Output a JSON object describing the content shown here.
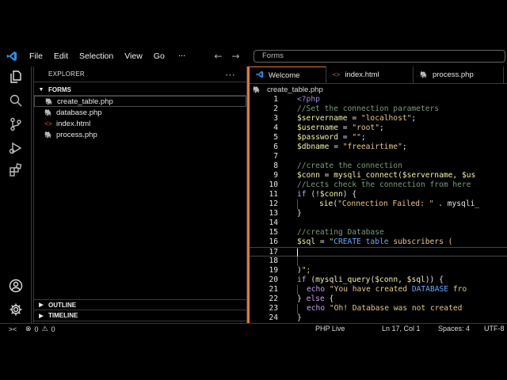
{
  "title_bar": {
    "menu": [
      "File",
      "Edit",
      "Selection",
      "View",
      "Go"
    ],
    "more": "···",
    "back_arrow": "←",
    "forward_arrow": "→",
    "command_center": "Forms"
  },
  "sidebar": {
    "header": "EXPLORER",
    "more": "···",
    "folder": "FORMS",
    "files": [
      {
        "name": "create_table.php",
        "icon": "php-icon",
        "active": true
      },
      {
        "name": "database.php",
        "icon": "php-icon"
      },
      {
        "name": "index.html",
        "icon": "html-icon",
        "glyph": "<>"
      },
      {
        "name": "process.php",
        "icon": "php-icon"
      }
    ],
    "outline": "OUTLINE",
    "timeline": "TIMELINE"
  },
  "editor": {
    "tabs": [
      {
        "label": "Welcome",
        "icon": "vscode-icon"
      },
      {
        "label": "index.html",
        "icon": "html-icon",
        "glyph": "<>"
      },
      {
        "label": "process.php",
        "icon": "php-icon"
      }
    ],
    "breadcrumb": "create_table.php",
    "lines": [
      {
        "n": "1",
        "text": "<?php"
      },
      {
        "n": "2",
        "text": "//Set the connection parameters"
      },
      {
        "n": "3",
        "text": "$servername = \"localhost\";"
      },
      {
        "n": "4",
        "text": "$username = \"root\";"
      },
      {
        "n": "5",
        "text": "$password = \"\";"
      },
      {
        "n": "6",
        "text": "$dbname = \"freeairtime\";"
      },
      {
        "n": "7",
        "text": ""
      },
      {
        "n": "8",
        "text": "//create the connection"
      },
      {
        "n": "9",
        "text": "$conn = mysqli_connect($servername, $us"
      },
      {
        "n": "10",
        "text": "//Lects check the connection from here"
      },
      {
        "n": "11",
        "text": "if (!$conn) {"
      },
      {
        "n": "12",
        "text": "sie(\"Connection Failed: \" . mysqli_"
      },
      {
        "n": "13",
        "text": "}"
      },
      {
        "n": "14",
        "text": ""
      },
      {
        "n": "15",
        "text": "//creating Database"
      },
      {
        "n": "16",
        "text": "$sql = \"CREATE table subscribers ("
      },
      {
        "n": "17",
        "text": ""
      },
      {
        "n": "18",
        "text": ""
      },
      {
        "n": "19",
        "text": ")\";"
      },
      {
        "n": "20",
        "text": "if (mysqli_query($conn, $sql)) {"
      },
      {
        "n": "21",
        "text": "echo \"You have created DATABASE fro"
      },
      {
        "n": "22",
        "text": "} else {"
      },
      {
        "n": "23",
        "text": "echo \"Oh! Database was not created"
      },
      {
        "n": "24",
        "text": "}"
      }
    ]
  },
  "status_bar": {
    "remote": "><",
    "errors": "0",
    "warnings": "0",
    "php_live": "PHP Live",
    "position": "Ln 17, Col 1",
    "spaces": "Spaces: 4",
    "encoding": "UTF-8"
  },
  "colors": {
    "accent": "#e07a32",
    "php_icon": "#9b8ad6",
    "html_icon": "#e06c4a",
    "vscode_blue": "#2f8fe6"
  }
}
